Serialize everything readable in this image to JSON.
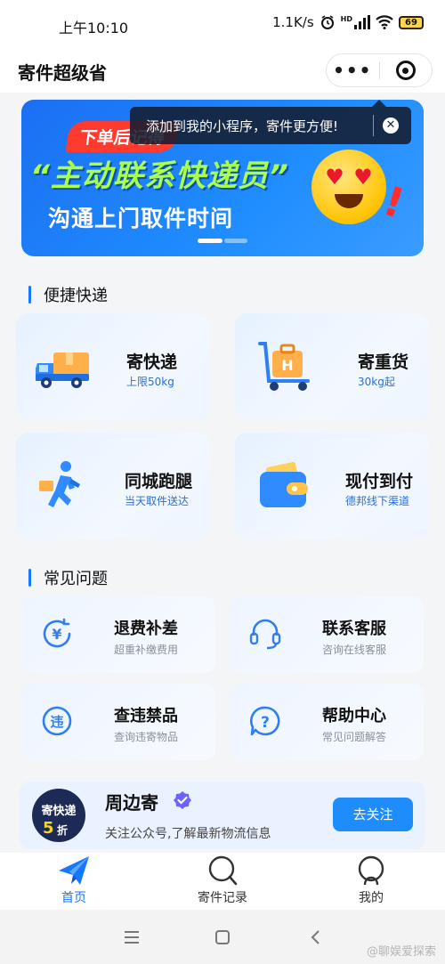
{
  "status_bar": {
    "time": "上午10:10",
    "network_speed": "1.1K/s",
    "hd_label": "HD",
    "battery": "69"
  },
  "header": {
    "title": "寄件超级省"
  },
  "tooltip": {
    "text": "添加到我的小程序，寄件更方便!"
  },
  "banner": {
    "tag": "下单后记得",
    "headline": "“主动联系快递员”",
    "subline": "沟通上门取件时间",
    "page_index": 1,
    "page_count": 2
  },
  "quick_delivery": {
    "section_title": "便捷快递",
    "cards": [
      {
        "title": "寄快递",
        "subtitle": "上限50kg",
        "icon": "delivery-truck-icon"
      },
      {
        "title": "寄重货",
        "subtitle": "30kg起",
        "icon": "luggage-cart-icon"
      },
      {
        "title": "同城跑腿",
        "subtitle": "当天取件送达",
        "icon": "running-courier-icon"
      },
      {
        "title": "现付到付",
        "subtitle": "德邦线下渠道",
        "icon": "wallet-icon"
      }
    ]
  },
  "faq": {
    "section_title": "常见问题",
    "items": [
      {
        "title": "退费补差",
        "subtitle": "超重补缴费用",
        "icon": "yen-refund-icon"
      },
      {
        "title": "联系客服",
        "subtitle": "咨询在线客服",
        "icon": "headset-icon"
      },
      {
        "title": "查违禁品",
        "subtitle": "查询违寄物品",
        "icon": "prohibited-icon",
        "icon_text": "违"
      },
      {
        "title": "帮助中心",
        "subtitle": "常见问题解答",
        "icon": "help-question-icon"
      }
    ]
  },
  "follow": {
    "badge_top": "寄快递",
    "badge_number": "5",
    "badge_unit": "折",
    "name": "周边寄",
    "description": "关注公众号,了解最新物流信息",
    "button_label": "去关注"
  },
  "tab_bar": {
    "tabs": [
      {
        "label": "首页",
        "icon": "paper-plane-icon",
        "active": true
      },
      {
        "label": "寄件记录",
        "icon": "search-record-icon",
        "active": false
      },
      {
        "label": "我的",
        "icon": "user-profile-icon",
        "active": false
      }
    ]
  },
  "watermark": "@聊娱爱探索",
  "colors": {
    "accent": "#1677ff",
    "banner_blue": "#1f8dff",
    "headline_green": "#a9ff4a",
    "tag_red": "#ff3b2f",
    "follow_button": "#1e8cfa"
  }
}
